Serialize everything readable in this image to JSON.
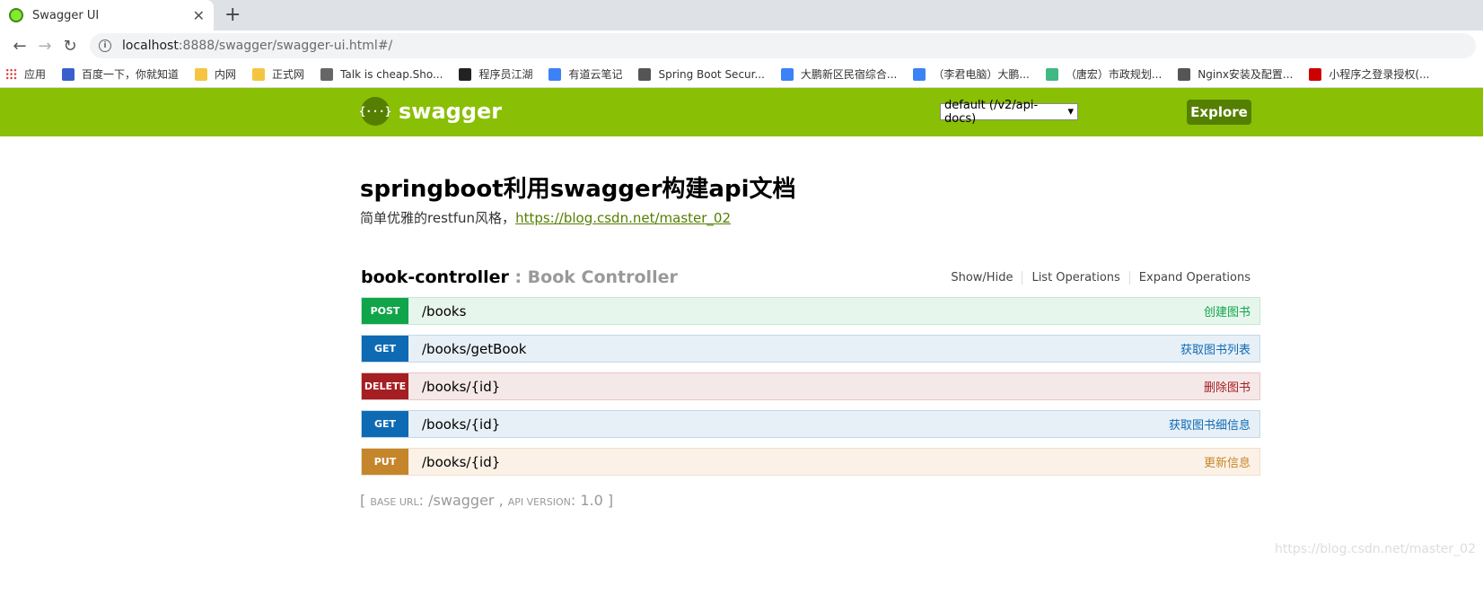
{
  "browser": {
    "tab_title": "Swagger UI",
    "tab_close": "✕",
    "new_tab": "+",
    "nav": {
      "back": "←",
      "forward": "→",
      "reload": "↻"
    },
    "url_host": "localhost",
    "url_path": ":8888/swagger/swagger-ui.html#/",
    "bookmarks": [
      {
        "label": "应用",
        "color": "#d33"
      },
      {
        "label": "百度一下，你就知道",
        "color": "#3a5fcd"
      },
      {
        "label": "内网",
        "color": "#f5c542"
      },
      {
        "label": "正式网",
        "color": "#f5c542"
      },
      {
        "label": "Talk is cheap.Sho...",
        "color": "#666"
      },
      {
        "label": "程序员江湖",
        "color": "#222"
      },
      {
        "label": "有道云笔记",
        "color": "#3b82f6"
      },
      {
        "label": "Spring Boot Secur...",
        "color": "#555"
      },
      {
        "label": "大鹏新区民宿综合...",
        "color": "#3b82f6"
      },
      {
        "label": "（李君电脑）大鹏...",
        "color": "#3b82f6"
      },
      {
        "label": "（唐宏）市政规划...",
        "color": "#41b883"
      },
      {
        "label": "Nginx安装及配置...",
        "color": "#555"
      },
      {
        "label": "小程序之登录授权(...",
        "color": "#c00"
      }
    ]
  },
  "swagger": {
    "logo_glyph": "{···}",
    "logo_text": "swagger",
    "spec_select": "default (/v2/api-docs)",
    "spec_arrow": "▾",
    "explore_label": "Explore"
  },
  "api": {
    "title": "springboot利用swagger构建api文档",
    "description": "简单优雅的restfun风格，",
    "link": "https://blog.csdn.net/master_02"
  },
  "controller": {
    "name": "book-controller",
    "description": " : Book Controller",
    "show_hide": "Show/Hide",
    "list_operations": "List Operations",
    "expand_operations": "Expand Operations"
  },
  "operations": [
    {
      "method": "POST",
      "path": "/books",
      "summary": "创建图书"
    },
    {
      "method": "GET",
      "path": "/books/getBook",
      "summary": "获取图书列表"
    },
    {
      "method": "DELETE",
      "path": "/books/{id}",
      "summary": "删除图书"
    },
    {
      "method": "GET",
      "path": "/books/{id}",
      "summary": "获取图书细信息"
    },
    {
      "method": "PUT",
      "path": "/books/{id}",
      "summary": "更新信息"
    }
  ],
  "footer": {
    "open_bracket": "[ ",
    "base_url_label": "Base URL",
    "base_url": ": /swagger , ",
    "api_version_label": "Api Version",
    "api_version": ": 1.0 ]"
  },
  "watermark": "https://blog.csdn.net/master_02"
}
